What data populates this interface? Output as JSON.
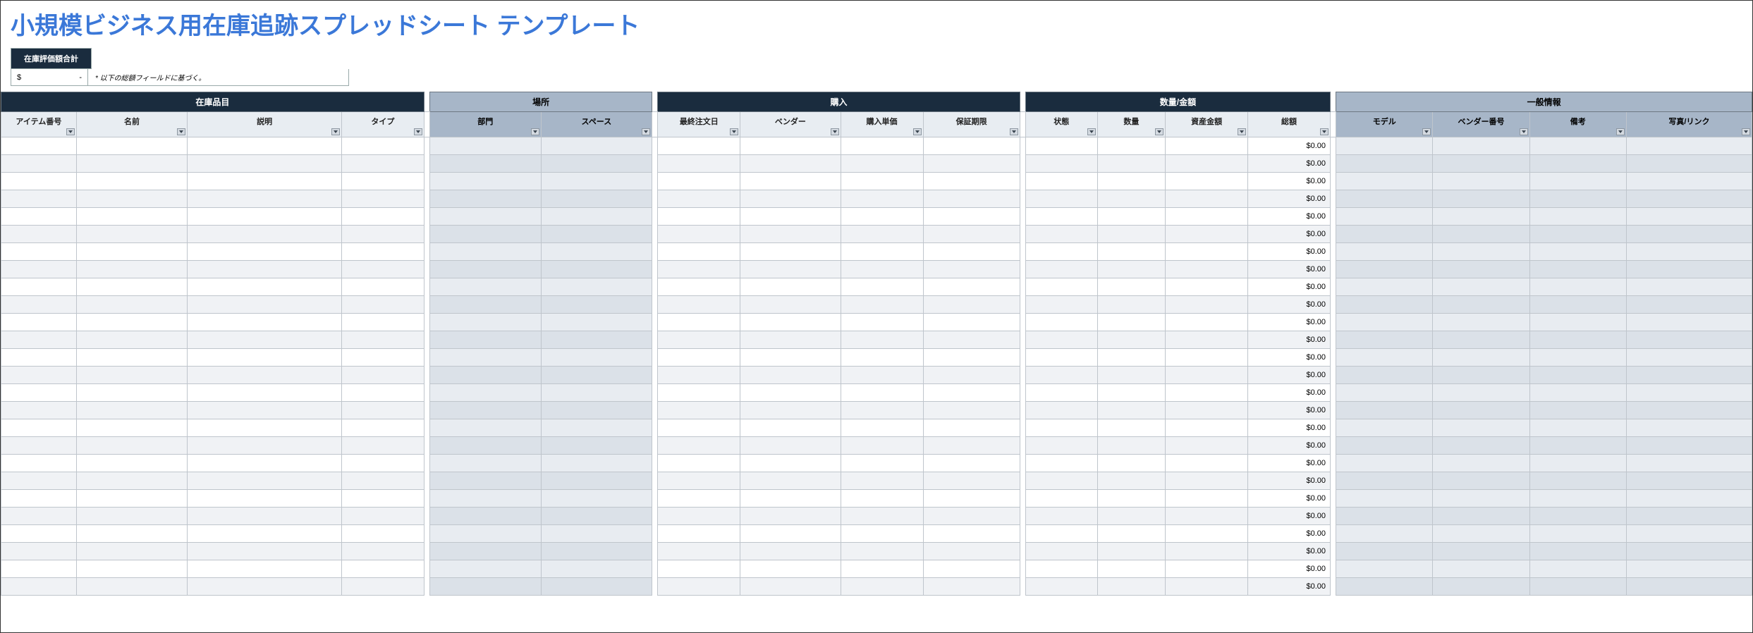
{
  "title": "小規模ビジネス用在庫追跡スプレッドシート テンプレート",
  "valuation": {
    "label": "在庫評価額合計",
    "currency": "$",
    "value": "-",
    "note": "* 以下の総額フィールドに基づく。"
  },
  "groups": {
    "inventory": "在庫品目",
    "location": "場所",
    "purchase": "購入",
    "qty_amount": "数量/金額",
    "general": "一般情報"
  },
  "columns": {
    "item_no": "アイテム番号",
    "name": "名前",
    "description": "説明",
    "type": "タイプ",
    "department": "部門",
    "space": "スペース",
    "last_order": "最終注文日",
    "vendor": "ベンダー",
    "unit_price": "購入単価",
    "warranty": "保証期限",
    "status": "状態",
    "quantity": "数量",
    "asset_amount": "資産金額",
    "total": "総額",
    "model": "モデル",
    "vendor_no": "ベンダー番号",
    "remarks": "備考",
    "photo_link": "写真/リンク"
  },
  "default_total": "$0.00",
  "row_count": 26
}
